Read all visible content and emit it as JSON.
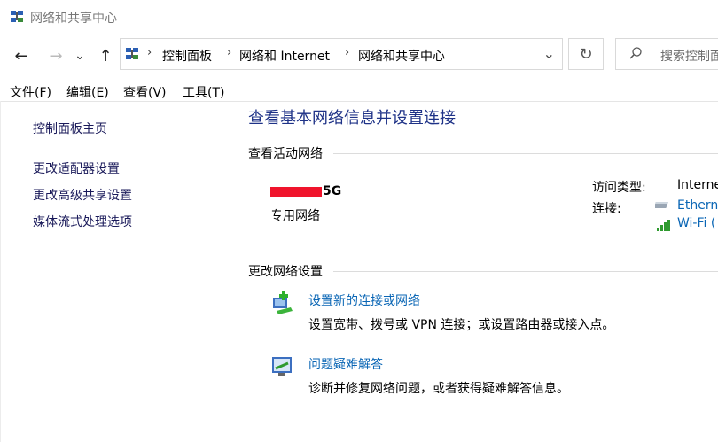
{
  "window": {
    "title": "网络和共享中心"
  },
  "nav": {
    "back": "←",
    "forward": "→",
    "recent": "⌄",
    "up": "↑",
    "breadcrumbs": [
      "控制面板",
      "网络和 Internet",
      "网络和共享中心"
    ],
    "separator": "›",
    "dropdown": "⌄",
    "refresh": "↻",
    "search_placeholder": "搜索控制面"
  },
  "menu": [
    "文件(F)",
    "编辑(E)",
    "查看(V)",
    "工具(T)"
  ],
  "sidebar": {
    "home": "控制面板主页",
    "links": [
      "更改适配器设置",
      "更改高级共享设置",
      "媒体流式处理选项"
    ]
  },
  "main": {
    "title": "查看基本网络信息并设置连接",
    "active_networks_heading": "查看活动网络",
    "network": {
      "name_suffix": "5G",
      "type": "专用网络",
      "access_type_label": "访问类型:",
      "access_type_value": "Interne",
      "connections_label": "连接:",
      "connection_ethernet": "Ethern",
      "connection_wifi": "Wi-Fi ("
    },
    "change_settings_heading": "更改网络设置",
    "tasks": [
      {
        "link": "设置新的连接或网络",
        "desc": "设置宽带、拨号或 VPN 连接；或设置路由器或接入点。",
        "icon": "new-connection-icon"
      },
      {
        "link": "问题疑难解答",
        "desc": "诊断并修复网络问题，或者获得疑难解答信息。",
        "icon": "troubleshoot-icon"
      }
    ]
  },
  "colors": {
    "link": "#0a66b5",
    "title": "#1e3287",
    "redaction": "#f0142c"
  }
}
